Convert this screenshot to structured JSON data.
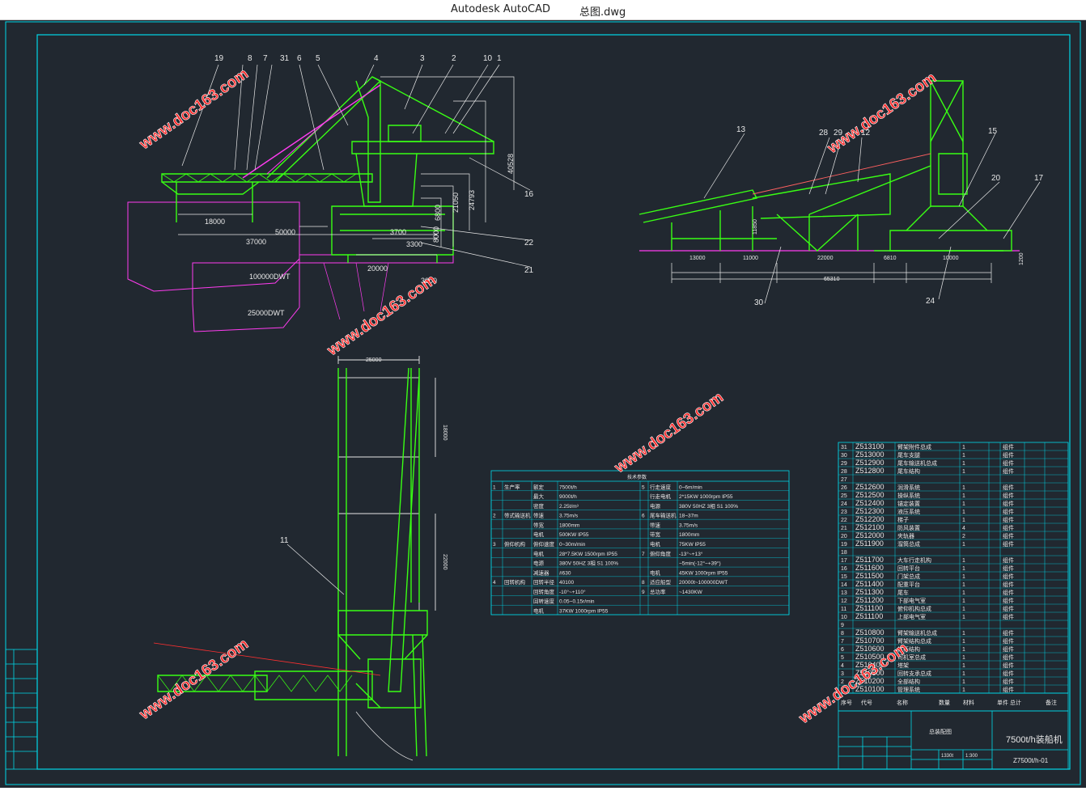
{
  "window": {
    "app_title": "Autodesk AutoCAD",
    "document_title": "总图.dwg"
  },
  "colors": {
    "canvas": "#212830",
    "frame": "#00d7e8",
    "structure": "#39ff14",
    "accent": "#ff3cf0",
    "dims": "#e8e8e8",
    "watermark": "#ff2a2a"
  },
  "watermark": "www.doc163.com",
  "side_view": {
    "part_numbers": [
      "19",
      "8",
      "7",
      "31",
      "6",
      "5",
      "4",
      "3",
      "2",
      "10",
      "1",
      "16",
      "22",
      "21"
    ],
    "dims": {
      "d18000": "18000",
      "d37000": "37000",
      "d50000": "50000",
      "d3700": "3700",
      "d3300": "3300",
      "d20000": "20000",
      "d8000": "8000",
      "d3000": "3000",
      "d6800": "6800",
      "d21050": "21050",
      "d24793": "24793",
      "d40528": "40528"
    },
    "ship_large": "100000DWT",
    "ship_small": "25000DWT"
  },
  "front_view": {
    "part_numbers": [
      "13",
      "28",
      "29",
      "12",
      "15",
      "20",
      "17",
      "30",
      "24"
    ],
    "dims": {
      "d1": "13000",
      "d2": "11000",
      "d3": "22000",
      "d4": "6810",
      "d5": "10000",
      "total": "65310",
      "h1": "11850",
      "h2": "1200"
    }
  },
  "plan_view": {
    "part_number": "11",
    "dims": {
      "top": "25000",
      "side1": "18000",
      "side2": "22000"
    }
  },
  "spec_table": {
    "title": "技术参数",
    "rows": [
      [
        "1",
        "生产率",
        "额定",
        "7500t/h",
        "5",
        "行走速度",
        "0~6m/min"
      ],
      [
        "",
        "",
        "最大",
        "9000t/h",
        "",
        "行走电机",
        "2*15KW 1000rpm IP55"
      ],
      [
        "",
        "",
        "密度",
        "2.25t/m³",
        "",
        "电源",
        "380V 50HZ 3相 S1 100%"
      ],
      [
        "2",
        "带式输送机",
        "带速",
        "3.75m/s",
        "6",
        "尾车输送机",
        "18~37m"
      ],
      [
        "",
        "",
        "带宽",
        "1800mm",
        "",
        "带速",
        "3.75m/s"
      ],
      [
        "",
        "",
        "电机",
        "500KW IP55",
        "",
        "带宽",
        "1800mm"
      ],
      [
        "3",
        "俯仰机构",
        "俯仰速度",
        "0~30m/min",
        "",
        "电机",
        "75KW IP55"
      ],
      [
        "",
        "",
        "电机",
        "28*7.5KW 1500rpm IP55",
        "7",
        "俯仰角度",
        "-13°~+13°"
      ],
      [
        "",
        "",
        "电源",
        "380V 50HZ 3相 S1 100%",
        "",
        "",
        "~5min(-12°~+39°)"
      ],
      [
        "",
        "",
        "减速器",
        "#630",
        "",
        "电机",
        "45KW 1000rpm IP55"
      ],
      [
        "4",
        "回转机构",
        "回转半径",
        "40100",
        "8",
        "适应船型",
        "20000t~100000DWT"
      ],
      [
        "",
        "",
        "回转角度",
        "-10°~+110°",
        "9",
        "总功率",
        "~1430KW"
      ],
      [
        "",
        "",
        "回转速度",
        "0.05~0.15r/min",
        "",
        "",
        ""
      ],
      [
        "",
        "",
        "电机",
        "37KW 1000rpm IP55",
        "",
        "",
        ""
      ]
    ]
  },
  "parts_list": {
    "rows": [
      [
        "31",
        "Z513100",
        "臂架附件总成",
        "1",
        "组件"
      ],
      [
        "30",
        "Z513000",
        "尾车支腿",
        "1",
        "组件"
      ],
      [
        "29",
        "Z512900",
        "尾车输送机总成",
        "1",
        "组件"
      ],
      [
        "28",
        "Z512800",
        "尾车结构",
        "1",
        "组件"
      ],
      [
        "27",
        "",
        "",
        "",
        ""
      ],
      [
        "26",
        "Z512600",
        "润滑系统",
        "1",
        "组件"
      ],
      [
        "25",
        "Z512500",
        "操纵系统",
        "1",
        "组件"
      ],
      [
        "24",
        "Z512400",
        "锚定装置",
        "1",
        "组件"
      ],
      [
        "23",
        "Z512300",
        "液压系统",
        "1",
        "组件"
      ],
      [
        "22",
        "Z512200",
        "梯子",
        "1",
        "组件"
      ],
      [
        "21",
        "Z512100",
        "防风装置",
        "4",
        "组件"
      ],
      [
        "20",
        "Z512000",
        "夹轨器",
        "2",
        "组件"
      ],
      [
        "19",
        "Z511900",
        "溜筒总成",
        "1",
        "组件"
      ],
      [
        "18",
        "",
        "",
        "",
        ""
      ],
      [
        "17",
        "Z511700",
        "大车行走机构",
        "1",
        "组件"
      ],
      [
        "16",
        "Z511600",
        "回转平台",
        "1",
        "组件"
      ],
      [
        "15",
        "Z511500",
        "门架总成",
        "1",
        "组件"
      ],
      [
        "14",
        "Z511400",
        "配重平台",
        "1",
        "组件"
      ],
      [
        "13",
        "Z511300",
        "尾车",
        "1",
        "组件"
      ],
      [
        "12",
        "Z511200",
        "下部电气室",
        "1",
        "组件"
      ],
      [
        "11",
        "Z511100",
        "俯仰机构总成",
        "1",
        "组件"
      ],
      [
        "10",
        "Z511100",
        "上部电气室",
        "1",
        "组件"
      ],
      [
        "9",
        "",
        "",
        "",
        ""
      ],
      [
        "8",
        "Z510800",
        "臂架输送机总成",
        "1",
        "组件"
      ],
      [
        "7",
        "Z510700",
        "臂架结构总成",
        "1",
        "组件"
      ],
      [
        "6",
        "Z510600",
        "拉杆结构",
        "1",
        "组件"
      ],
      [
        "5",
        "Z510500",
        "司机室总成",
        "1",
        "组件"
      ],
      [
        "4",
        "Z510400",
        "塔架",
        "1",
        "组件"
      ],
      [
        "3",
        "Z510300",
        "回转支承总成",
        "1",
        "组件"
      ],
      [
        "2",
        "Z510200",
        "全部结构",
        "1",
        "组件"
      ],
      [
        "1",
        "Z510100",
        "管理系统",
        "1",
        "组件"
      ]
    ],
    "header": [
      "序号",
      "代号",
      "名称",
      "数量",
      "材料",
      "单件",
      "总计",
      "备注"
    ]
  },
  "title_block": {
    "name": "7500t/h装船机",
    "drawing_no": "Z7500t/h-01",
    "scale": "1:300",
    "weight": "1330t",
    "company": "总装配图"
  }
}
